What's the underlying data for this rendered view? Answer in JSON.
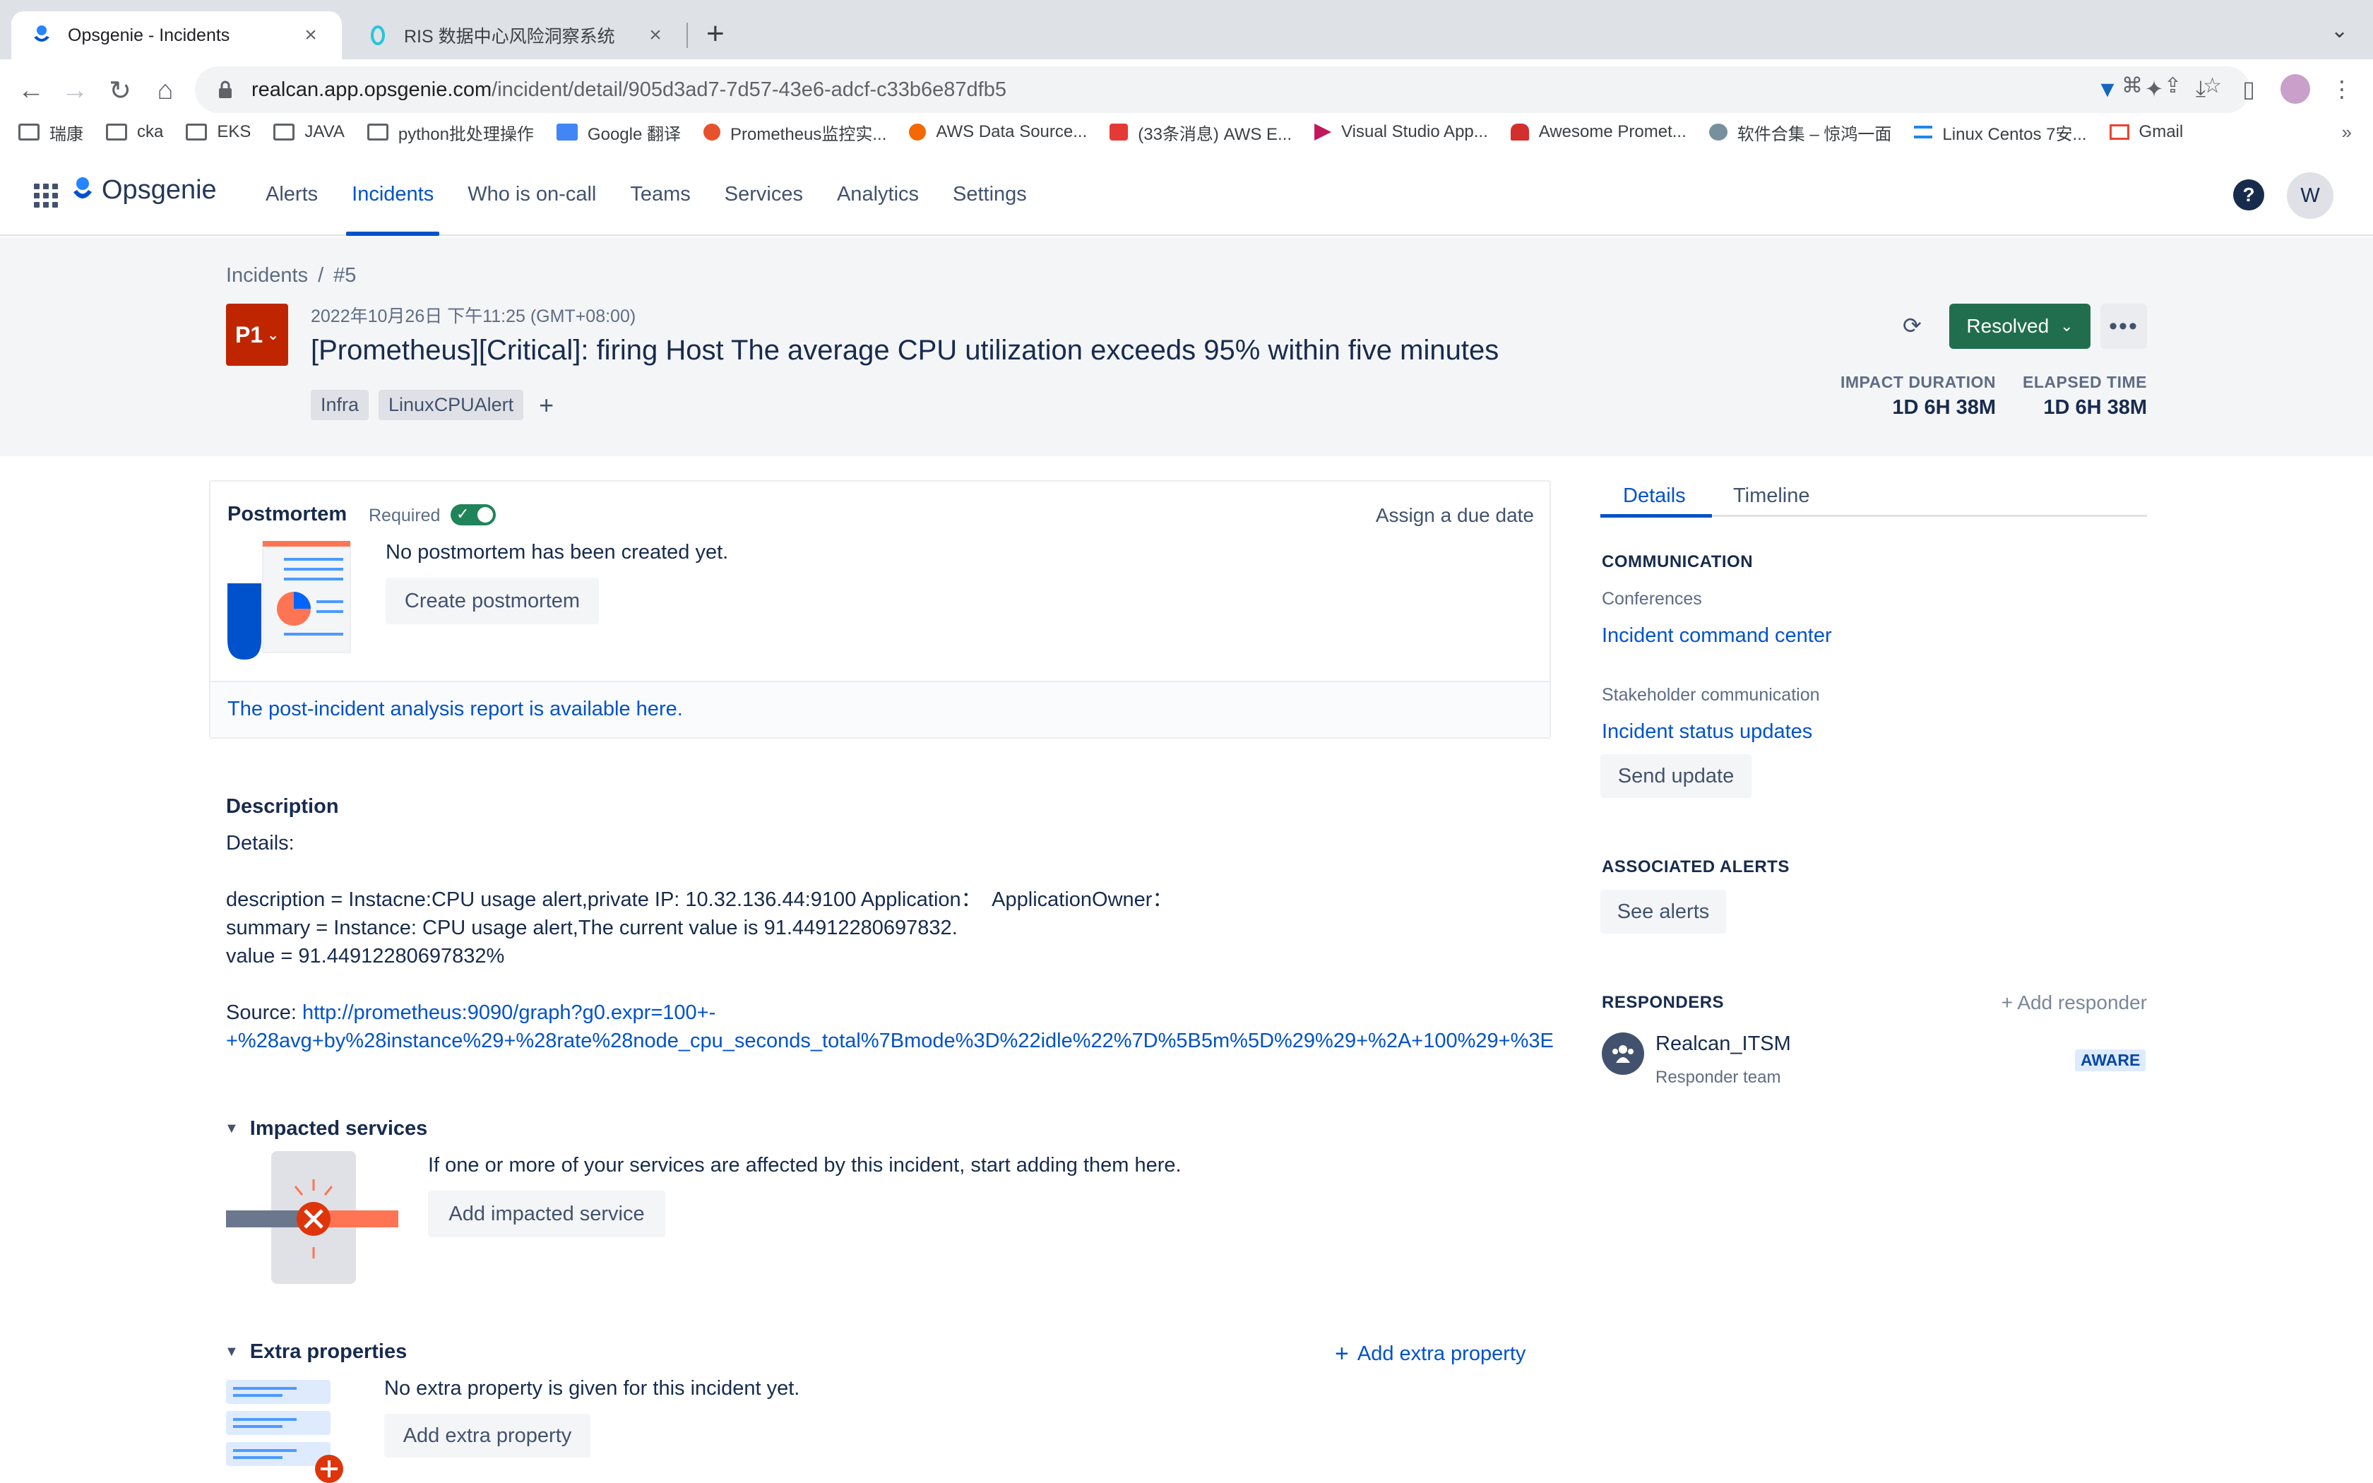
{
  "browser": {
    "tabs": [
      {
        "title": "Opsgenie - Incidents",
        "active": true
      },
      {
        "title": "RIS 数据中心风险洞察系统",
        "active": false
      }
    ],
    "url_host": "realcan.app.opsgenie.com",
    "url_path": "/incident/detail/905d3ad7-7d57-43e6-adcf-c33b6e87dfb5",
    "bookmarks": [
      {
        "label": "瑞康",
        "icon": "folder-icon"
      },
      {
        "label": "cka",
        "icon": "folder-icon"
      },
      {
        "label": "EKS",
        "icon": "folder-icon"
      },
      {
        "label": "JAVA",
        "icon": "folder-icon"
      },
      {
        "label": "python批处理操作",
        "icon": "folder-icon"
      },
      {
        "label": "Google 翻译",
        "icon": "google-translate-icon"
      },
      {
        "label": "Prometheus监控实...",
        "icon": "prometheus-icon"
      },
      {
        "label": "AWS Data Source...",
        "icon": "grafana-icon"
      },
      {
        "label": "(33条消息) AWS E...",
        "icon": "csdn-icon"
      },
      {
        "label": "Visual Studio App...",
        "icon": "visual-studio-icon"
      },
      {
        "label": "Awesome Promet...",
        "icon": "alarm-icon"
      },
      {
        "label": "软件合集 – 惊鸿一面",
        "icon": "globe-icon"
      },
      {
        "label": "Linux Centos 7安...",
        "icon": "layers-icon"
      },
      {
        "label": "Gmail",
        "icon": "gmail-icon"
      }
    ]
  },
  "app": {
    "brand": "Opsgenie",
    "nav": [
      "Alerts",
      "Incidents",
      "Who is on-call",
      "Teams",
      "Services",
      "Analytics",
      "Settings"
    ],
    "active_nav": "Incidents",
    "avatar_initial": "W",
    "help": "?"
  },
  "incident": {
    "breadcrumb_root": "Incidents",
    "breadcrumb_sep": "/",
    "breadcrumb_id": "#5",
    "priority": "P1",
    "created": "2022年10月26日 下午11:25 (GMT+08:00)",
    "title": "[Prometheus][Critical]: firing Host The average CPU utilization exceeds 95% within five minutes",
    "tags": [
      "Infra",
      "LinuxCPUAlert"
    ],
    "add_tag": "+",
    "status": "Resolved",
    "impact_label": "IMPACT DURATION",
    "impact_value": "1D 6H 38M",
    "elapsed_label": "ELAPSED TIME",
    "elapsed_value": "1D 6H 38M"
  },
  "postmortem": {
    "title": "Postmortem",
    "required_label": "Required",
    "required_on": true,
    "due_date": "Assign a due date",
    "message": "No postmortem has been created yet.",
    "create_button": "Create postmortem",
    "footer_link": "The post-incident analysis report is available here."
  },
  "description": {
    "title": "Description",
    "line1": "Details:",
    "line2": "description = Instacne:CPU usage alert,private IP: 10.32.136.44:9100 Application：  ApplicationOwner：",
    "line3": "summary = Instance: CPU usage alert,The current value is 91.44912280697832.",
    "line4": "value = 91.44912280697832%",
    "source_label": "Source: ",
    "source_url_1": "http://prometheus:9090/graph?g0.expr=100+-",
    "source_url_2": "+%28avg+by%28instance%29+%28rate%28node_cpu_seconds_total%7Bmode%3D%22idle%22%7D%5B5m%5D%29%29+%2A+100%29+%3E"
  },
  "impacted": {
    "title": "Impacted services",
    "message": "If one or more of your services are affected by this incident, start adding them here.",
    "button": "Add impacted service"
  },
  "extra": {
    "title": "Extra properties",
    "add_link": "Add extra property",
    "message": "No extra property is given for this incident yet.",
    "button": "Add extra property"
  },
  "sidebar": {
    "tabs": [
      "Details",
      "Timeline"
    ],
    "communication": "COMMUNICATION",
    "conferences": "Conferences",
    "conference_link": "Incident command center",
    "stakeholder": "Stakeholder communication",
    "stakeholder_link": "Incident status updates",
    "send_update": "Send update",
    "associated": "ASSOCIATED ALERTS",
    "see_alerts": "See alerts",
    "responders": "RESPONDERS",
    "add_responder": "Add responder",
    "responder_name": "Realcan_ITSM",
    "responder_type": "Responder team",
    "responder_state": "AWARE"
  },
  "colors": {
    "primary": "#0052cc",
    "resolved": "#216e4e",
    "p1": "#bf2600",
    "band": "#f4f5f7"
  }
}
